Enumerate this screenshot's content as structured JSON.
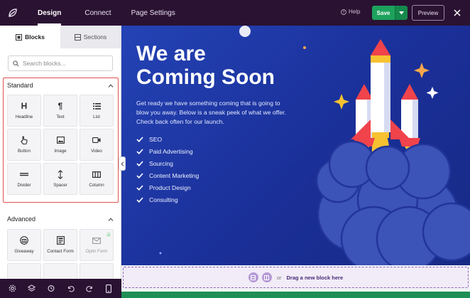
{
  "topbar": {
    "tabs": [
      {
        "label": "Design",
        "active": true
      },
      {
        "label": "Connect",
        "active": false
      },
      {
        "label": "Page Settings",
        "active": false
      }
    ],
    "help_label": "Help",
    "save_label": "Save",
    "preview_label": "Preview",
    "colors": {
      "bar": "#2a1232",
      "save": "#1da25c"
    }
  },
  "sidebar": {
    "tabs": [
      {
        "label": "Blocks",
        "icon": "blocks-icon",
        "active": true
      },
      {
        "label": "Sections",
        "icon": "sections-icon",
        "active": false
      }
    ],
    "search_placeholder": "Search blocks...",
    "standard": {
      "title": "Standard",
      "blocks": [
        {
          "label": "Headline",
          "icon": "headline-icon"
        },
        {
          "label": "Text",
          "icon": "paragraph-icon"
        },
        {
          "label": "List",
          "icon": "list-icon"
        },
        {
          "label": "Button",
          "icon": "pointer-icon"
        },
        {
          "label": "Image",
          "icon": "image-icon"
        },
        {
          "label": "Video",
          "icon": "video-icon"
        },
        {
          "label": "Divider",
          "icon": "divider-icon"
        },
        {
          "label": "Spacer",
          "icon": "spacer-icon"
        },
        {
          "label": "Column",
          "icon": "column-icon"
        }
      ]
    },
    "advanced": {
      "title": "Advanced",
      "blocks": [
        {
          "label": "Giveaway",
          "icon": "giveaway-icon",
          "locked": false
        },
        {
          "label": "Contact Form",
          "icon": "contact-form-icon",
          "locked": false
        },
        {
          "label": "Optin Form",
          "icon": "mail-icon",
          "locked": true
        }
      ]
    },
    "bottom_tools": [
      "settings-icon",
      "layers-icon",
      "history-icon",
      "undo-icon",
      "redo-icon",
      "mobile-preview-icon"
    ]
  },
  "canvas": {
    "title": "We are Coming Soon",
    "title_line1": "We are",
    "title_line2": "Coming Soon",
    "body": "Get ready we have something coming that is going to blow you away. Below is a sneak peek of what we offer. Check back often for our launch.",
    "features": [
      "SEO",
      "Paid Advertising",
      "Sourcing",
      "Content Marketing",
      "Product Design",
      "Consulting"
    ],
    "colors": {
      "background": "#1f3aa8",
      "rocket_red": "#f0434b",
      "star_yellow": "#f7c231"
    }
  },
  "dropzone": {
    "or_label": "or",
    "action_label": "Drag a new block here"
  }
}
